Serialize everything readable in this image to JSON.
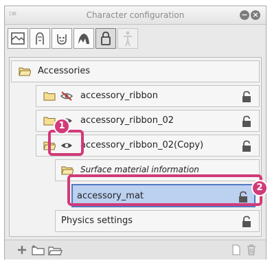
{
  "window": {
    "title": "Character configuration"
  },
  "toolbar": {
    "icons": [
      "texture-icon",
      "head-icon",
      "face-icon",
      "hair-icon",
      "accessory-icon",
      "body-icon"
    ],
    "active_index": 4
  },
  "tree": {
    "root": {
      "label": "Accessories"
    },
    "items": [
      {
        "label": "accessory_ribbon",
        "visible": false
      },
      {
        "label": "accessory_ribbon_02",
        "visible": true
      },
      {
        "label": "accessory_ribbon_02(Copy)",
        "visible": true
      }
    ],
    "surface": {
      "label": "Surface material information"
    },
    "material": {
      "label": "accessory_mat"
    },
    "physics": {
      "label": "Physics settings"
    }
  },
  "callouts": {
    "one": "1",
    "two": "2"
  },
  "colors": {
    "highlight": "#d23a79",
    "selection": "#bcd0ef"
  }
}
